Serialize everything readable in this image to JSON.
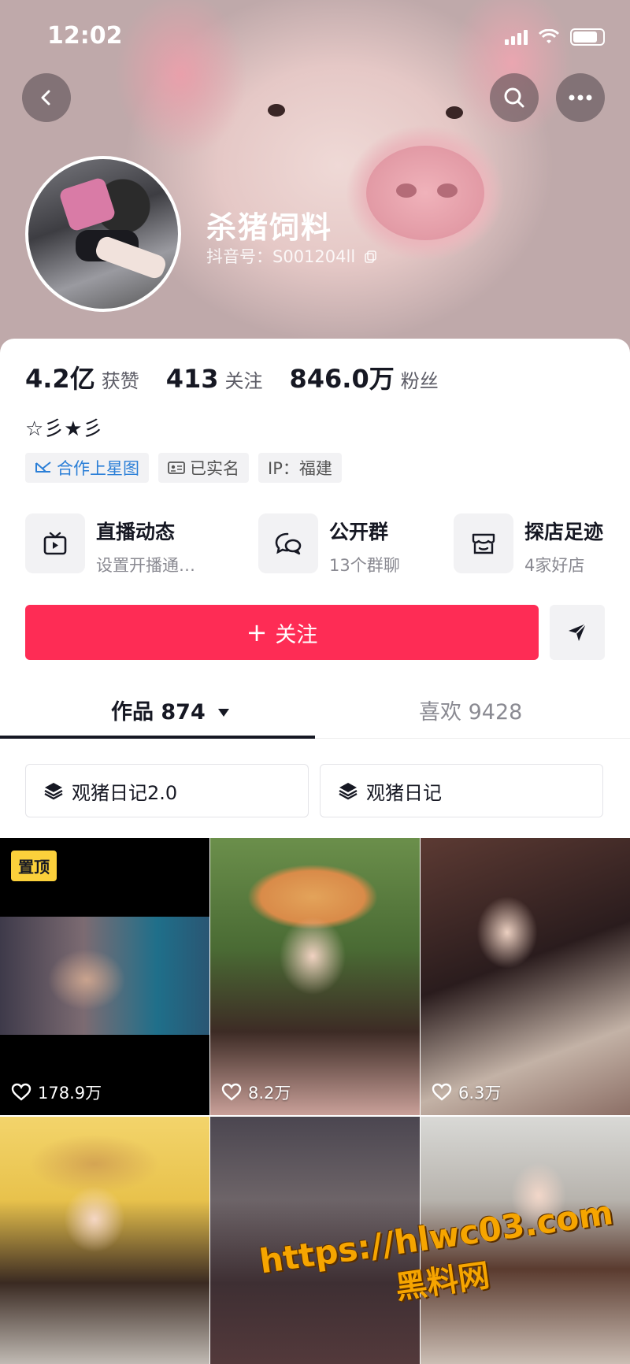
{
  "status_bar": {
    "time": "12:02"
  },
  "profile": {
    "name": "杀猪饲料",
    "douyin_id": "抖音号：S001204ll"
  },
  "stats": [
    {
      "value": "4.2亿",
      "label": "获赞"
    },
    {
      "value": "413",
      "label": "关注"
    },
    {
      "value": "846.0万",
      "label": "粉丝"
    }
  ],
  "bio": "☆彡★彡",
  "tags": [
    {
      "label": "合作上星图",
      "icon": "star-map-icon"
    },
    {
      "label": "已实名",
      "icon": "id-card-icon"
    },
    {
      "label": "IP：福建",
      "icon": ""
    }
  ],
  "entries": [
    {
      "title": "直播动态",
      "subtitle": "设置开播通…",
      "icon": "tv-icon"
    },
    {
      "title": "公开群",
      "subtitle": "13个群聊",
      "icon": "chat-group-icon"
    },
    {
      "title": "探店足迹",
      "subtitle": "4家好店",
      "icon": "shop-icon"
    }
  ],
  "actions": {
    "follow_label": "关注",
    "follow_prefix": "+"
  },
  "tabs": {
    "works": "作品 874",
    "likes": "喜欢 9428"
  },
  "collections": [
    {
      "label": "观猪日记2.0",
      "icon": "layers-icon"
    },
    {
      "label": "观猪日记",
      "icon": "layers-icon"
    }
  ],
  "videos": [
    {
      "likes": "178.9万",
      "pinned": "置顶"
    },
    {
      "likes": "8.2万",
      "pinned": ""
    },
    {
      "likes": "6.3万",
      "pinned": ""
    },
    {
      "likes": "",
      "pinned": ""
    },
    {
      "likes": "",
      "pinned": ""
    },
    {
      "likes": "",
      "pinned": ""
    }
  ],
  "watermark": {
    "line1": "https://hlwc03.com",
    "line2": "黑料网"
  },
  "colors": {
    "accent": "#fe2c55",
    "pin_badge": "#fbd03b",
    "watermark": "#f6a500",
    "link_blue": "#2b7fd7"
  }
}
